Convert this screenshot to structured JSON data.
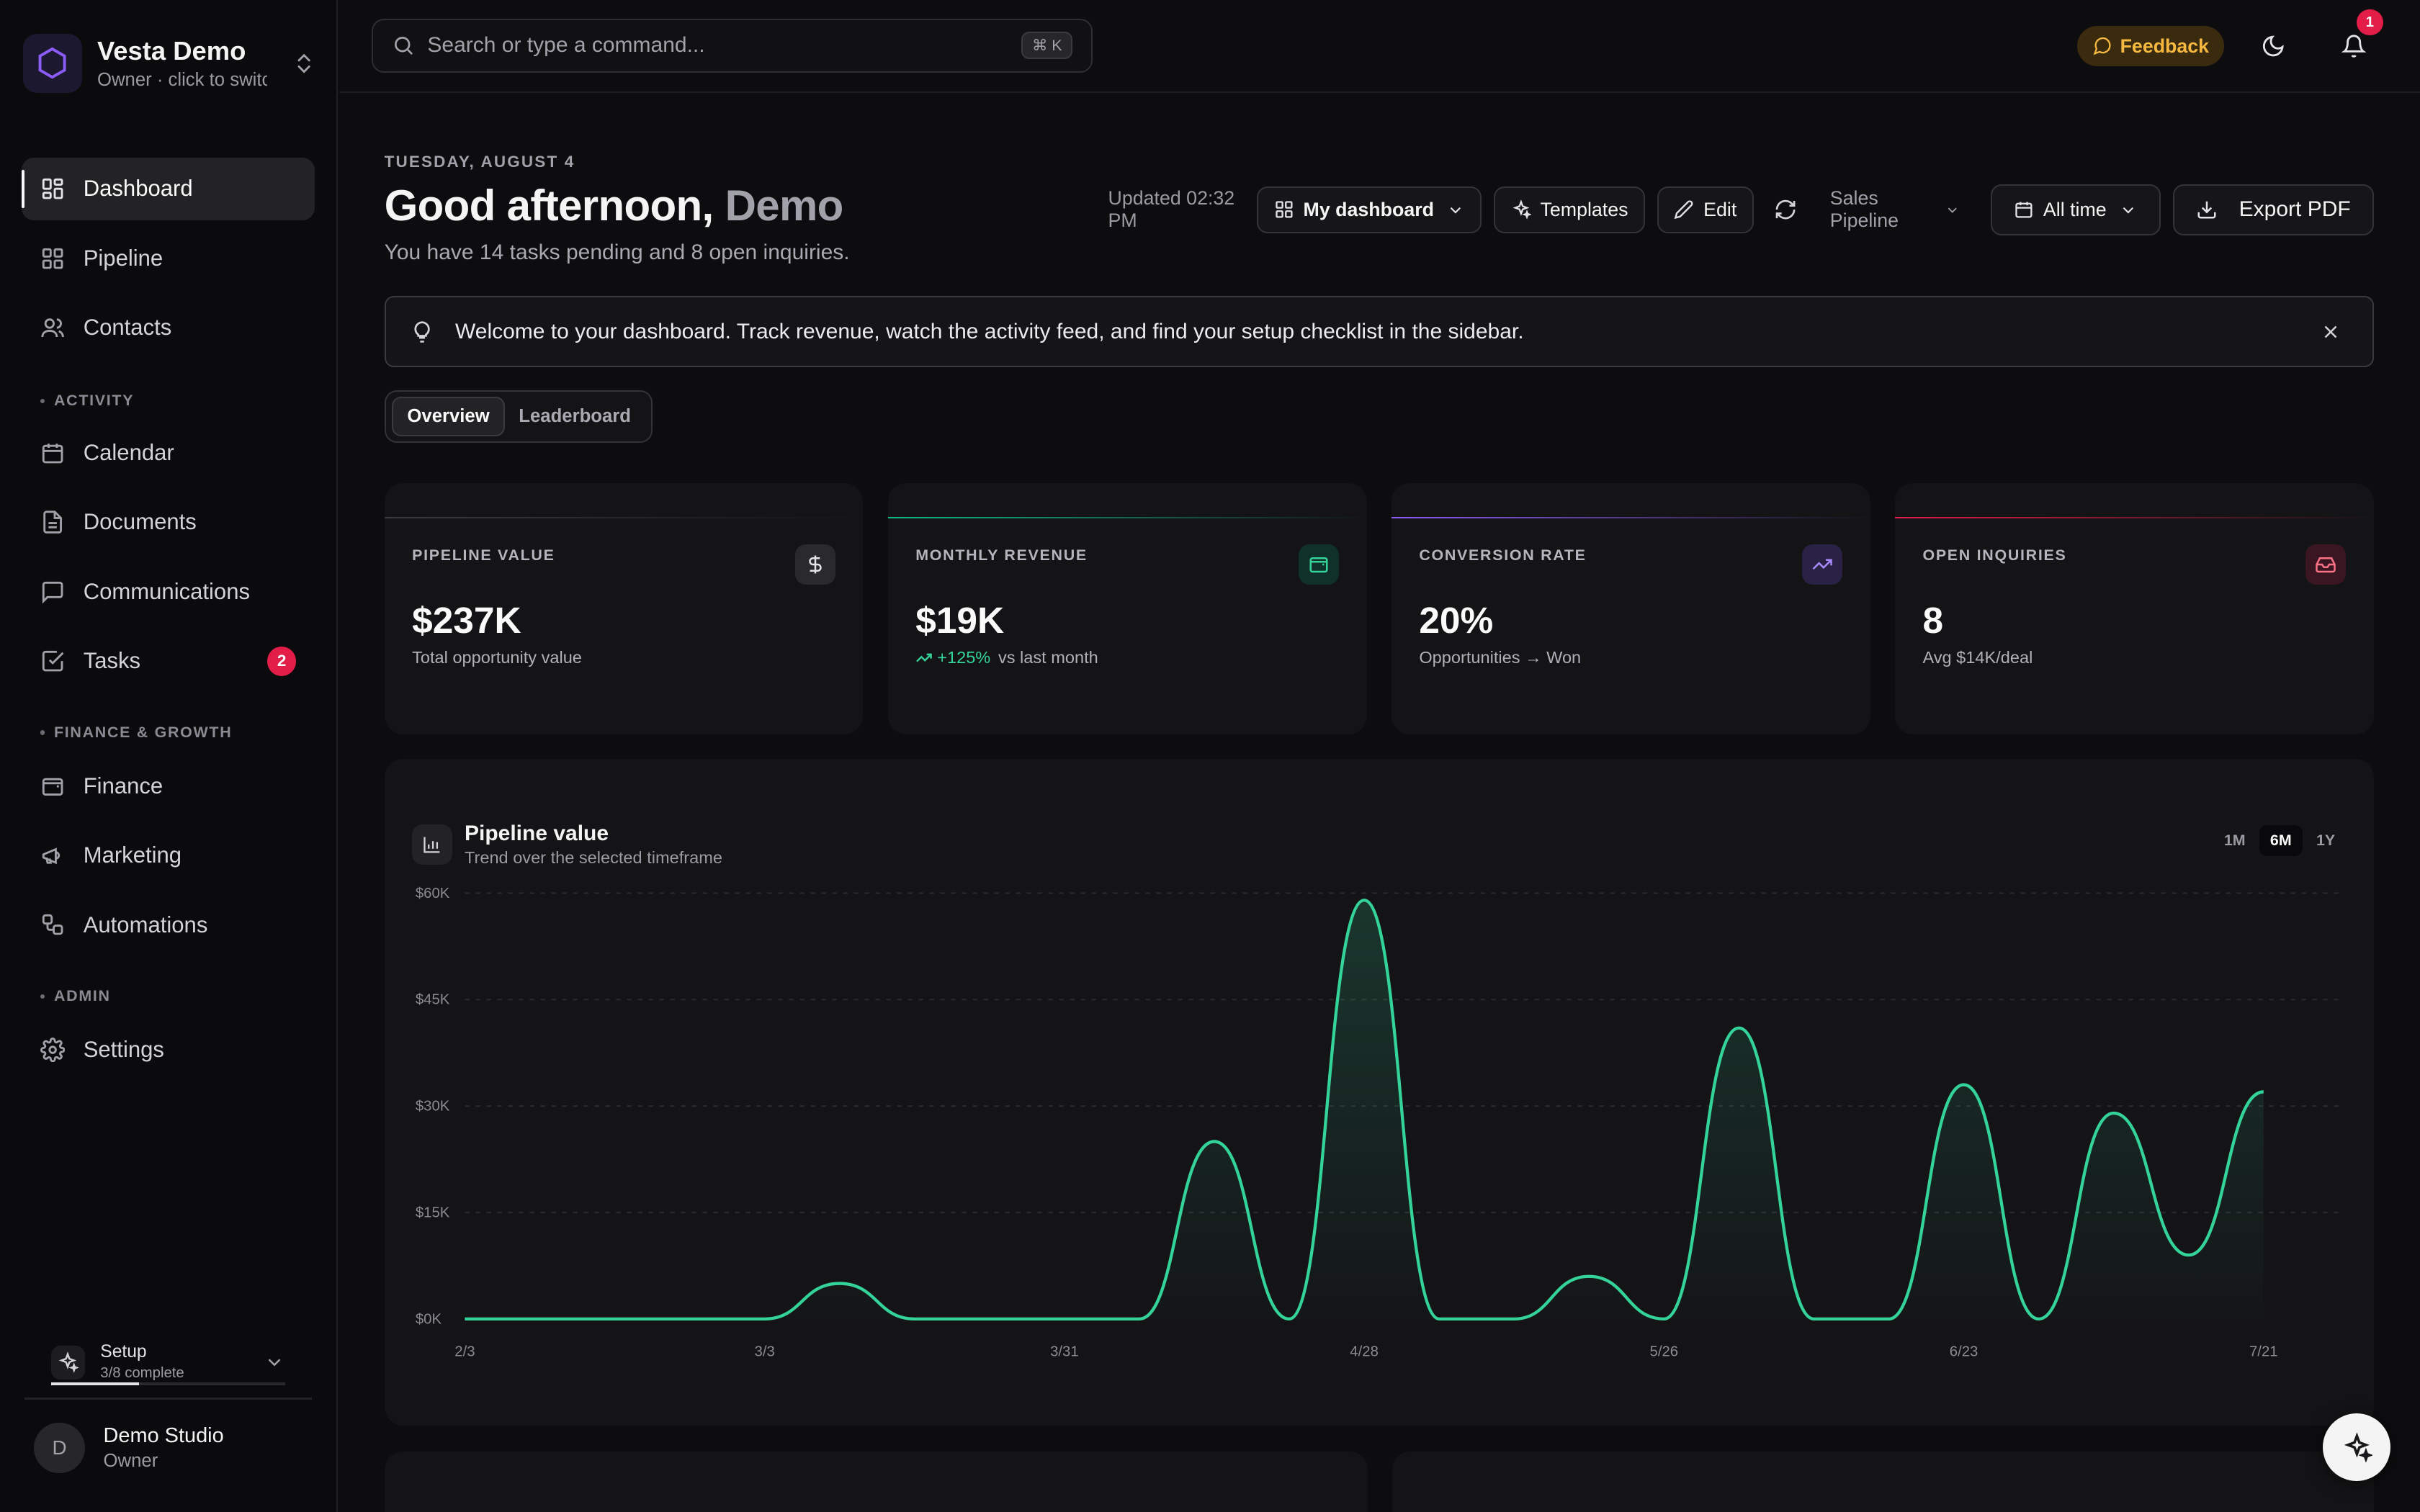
{
  "workspace": {
    "name": "Vesta Demo",
    "subtitle": "Owner · click to switch"
  },
  "nav": {
    "dashboard": "Dashboard",
    "pipeline": "Pipeline",
    "contacts": "Contacts",
    "section_activity": "ACTIVITY",
    "calendar": "Calendar",
    "documents": "Documents",
    "communications": "Communications",
    "tasks": "Tasks",
    "tasks_badge": "2",
    "section_finance": "FINANCE & GROWTH",
    "finance": "Finance",
    "marketing": "Marketing",
    "automations": "Automations",
    "section_admin": "ADMIN",
    "settings": "Settings"
  },
  "setup": {
    "title": "Setup",
    "progress_text": "3/8 complete",
    "completed": 3,
    "total": 8
  },
  "user": {
    "initial": "D",
    "name": "Demo Studio",
    "role": "Owner"
  },
  "topbar": {
    "search_placeholder": "Search or type a command...",
    "shortcut": "⌘ K",
    "feedback": "Feedback",
    "notifications_count": "1"
  },
  "header": {
    "date": "TUESDAY, AUGUST 4",
    "greeting": "Good afternoon,",
    "name": "Demo",
    "subtitle": "You have 14 tasks pending and 8 open inquiries."
  },
  "toolbar": {
    "updated": "Updated 02:32 PM",
    "dashboard_select": "My dashboard",
    "templates": "Templates",
    "edit": "Edit",
    "pipeline_select": "Sales Pipeline",
    "period_select": "All time",
    "export": "Export PDF"
  },
  "banner": {
    "message": "Welcome to your dashboard. Track revenue, watch the activity feed, and find your setup checklist in the sidebar."
  },
  "tabs": {
    "overview": "Overview",
    "leaderboard": "Leaderboard"
  },
  "kpis": [
    {
      "label": "PIPELINE VALUE",
      "value": "$237K",
      "caption": "Total opportunity value",
      "icon": "dollar-icon",
      "accent": "#3a3a40"
    },
    {
      "label": "MONTHLY REVENUE",
      "value": "$19K",
      "delta": "+125%",
      "caption": "vs last month",
      "icon": "wallet-icon",
      "accent": "#10b981"
    },
    {
      "label": "CONVERSION RATE",
      "value": "20%",
      "caption": "Opportunities → Won",
      "icon": "trending-up-icon",
      "accent": "#8b5cf6"
    },
    {
      "label": "OPEN INQUIRIES",
      "value": "8",
      "caption": "Avg $14K/deal",
      "icon": "inbox-icon",
      "accent": "#e11d48"
    }
  ],
  "chart": {
    "title": "Pipeline value",
    "subtitle": "Trend over the selected timeframe",
    "ranges": [
      "1M",
      "6M",
      "1Y"
    ],
    "active_range": "6M"
  },
  "chart_data": {
    "type": "area",
    "title": "Pipeline value",
    "ylim": [
      0,
      60000
    ],
    "y_ticks": [
      "$0K",
      "$15K",
      "$30K",
      "$45K",
      "$60K"
    ],
    "y_tick_values": [
      0,
      15000,
      30000,
      45000,
      60000
    ],
    "x_ticks": [
      "2/3",
      "3/3",
      "3/31",
      "4/28",
      "5/26",
      "6/23",
      "7/21"
    ],
    "x": [
      "2/3",
      "2/10",
      "2/17",
      "2/24",
      "3/3",
      "3/10",
      "3/17",
      "3/24",
      "3/31",
      "4/7",
      "4/14",
      "4/21",
      "4/28",
      "5/5",
      "5/12",
      "5/19",
      "5/26",
      "6/2",
      "6/9",
      "6/16",
      "6/23",
      "6/30",
      "7/7",
      "7/14",
      "7/21",
      "7/28"
    ],
    "series": [
      {
        "values": [
          0,
          0,
          0,
          0,
          0,
          5000,
          0,
          0,
          0,
          0,
          25000,
          0,
          59000,
          0,
          0,
          6000,
          0,
          41000,
          0,
          0,
          33000,
          0,
          29000,
          9000,
          32000,
          null
        ],
        "color": "#34d399"
      }
    ],
    "grid": true,
    "legend": "none"
  }
}
